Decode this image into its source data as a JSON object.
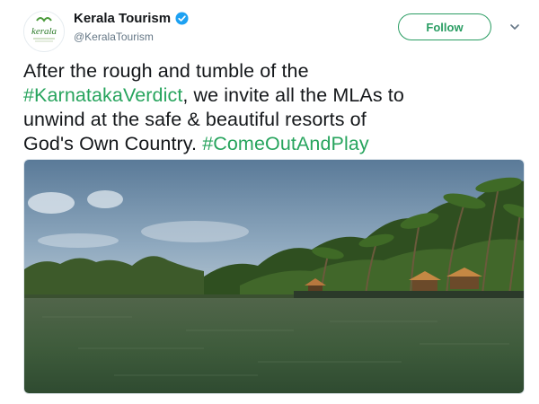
{
  "account": {
    "display_name": "Kerala Tourism",
    "handle": "@KeralaTourism",
    "verified": true,
    "avatar_logo_text": "kerala"
  },
  "actions": {
    "follow_label": "Follow",
    "more_icon": "chevron-down-icon"
  },
  "tweet": {
    "line1": "After the rough and tumble of the",
    "hashtag1": "#KarnatakaVerdict",
    "line2_rest": ", we invite all the MLAs to",
    "line3": "unwind at the safe & beautiful resorts of",
    "line4": "God's Own Country. ",
    "hashtag2": "#ComeOutAndPlay"
  },
  "colors": {
    "hashtag": "#27a45d",
    "follow_border": "#2a9d63",
    "verified_badge": "#1da1f2",
    "handle_text": "#657786"
  },
  "media": {
    "type": "photo",
    "icon": "backwater-landscape-photo"
  }
}
